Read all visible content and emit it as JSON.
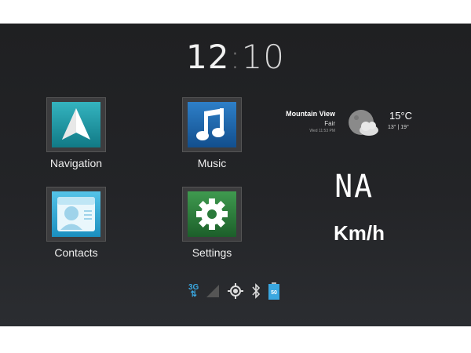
{
  "clock": {
    "hours": "12",
    "separator": ":",
    "minutes": "10"
  },
  "apps": [
    {
      "label": "Navigation",
      "icon": "navigation-arrow-icon"
    },
    {
      "label": "Music",
      "icon": "music-note-icon"
    },
    {
      "label": "Contacts",
      "icon": "contacts-card-icon"
    },
    {
      "label": "Settings",
      "icon": "gear-icon"
    }
  ],
  "weather": {
    "city": "Mountain View",
    "condition": "Fair",
    "updated": "Wed 11:53 PM",
    "temperature": "15°C",
    "range": "13° | 19°",
    "icon": "moon-cloud-icon"
  },
  "speed": {
    "value": "NA",
    "unit": "Km/h"
  },
  "status": {
    "network": "3G",
    "battery": "50"
  },
  "colors": {
    "network_blue": "#3aa7e0",
    "background": "#232427"
  }
}
